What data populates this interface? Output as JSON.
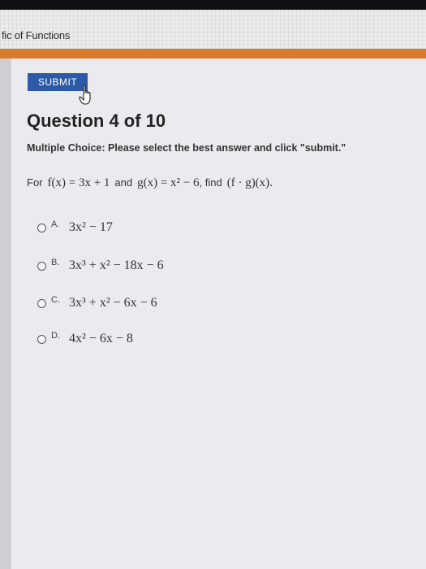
{
  "breadcrumb": "fic of Functions",
  "submit_button": {
    "label": "SUBMIT"
  },
  "question": {
    "title": "Question 4 of 10",
    "instructions": "Multiple Choice: Please select the best answer and click \"submit.\"",
    "prompt": {
      "intro": "For",
      "f_def": "f(x) = 3x + 1",
      "and_text": "and",
      "g_def": "g(x) = x² − 6",
      "find_text": ", find",
      "target": "(f · g)(x)."
    }
  },
  "choices": [
    {
      "letter": "A.",
      "expression": "3x² − 17"
    },
    {
      "letter": "B.",
      "expression": "3x³ + x² − 18x − 6"
    },
    {
      "letter": "C.",
      "expression": "3x³ + x² − 6x − 6"
    },
    {
      "letter": "D.",
      "expression": "4x² − 6x − 8"
    }
  ]
}
